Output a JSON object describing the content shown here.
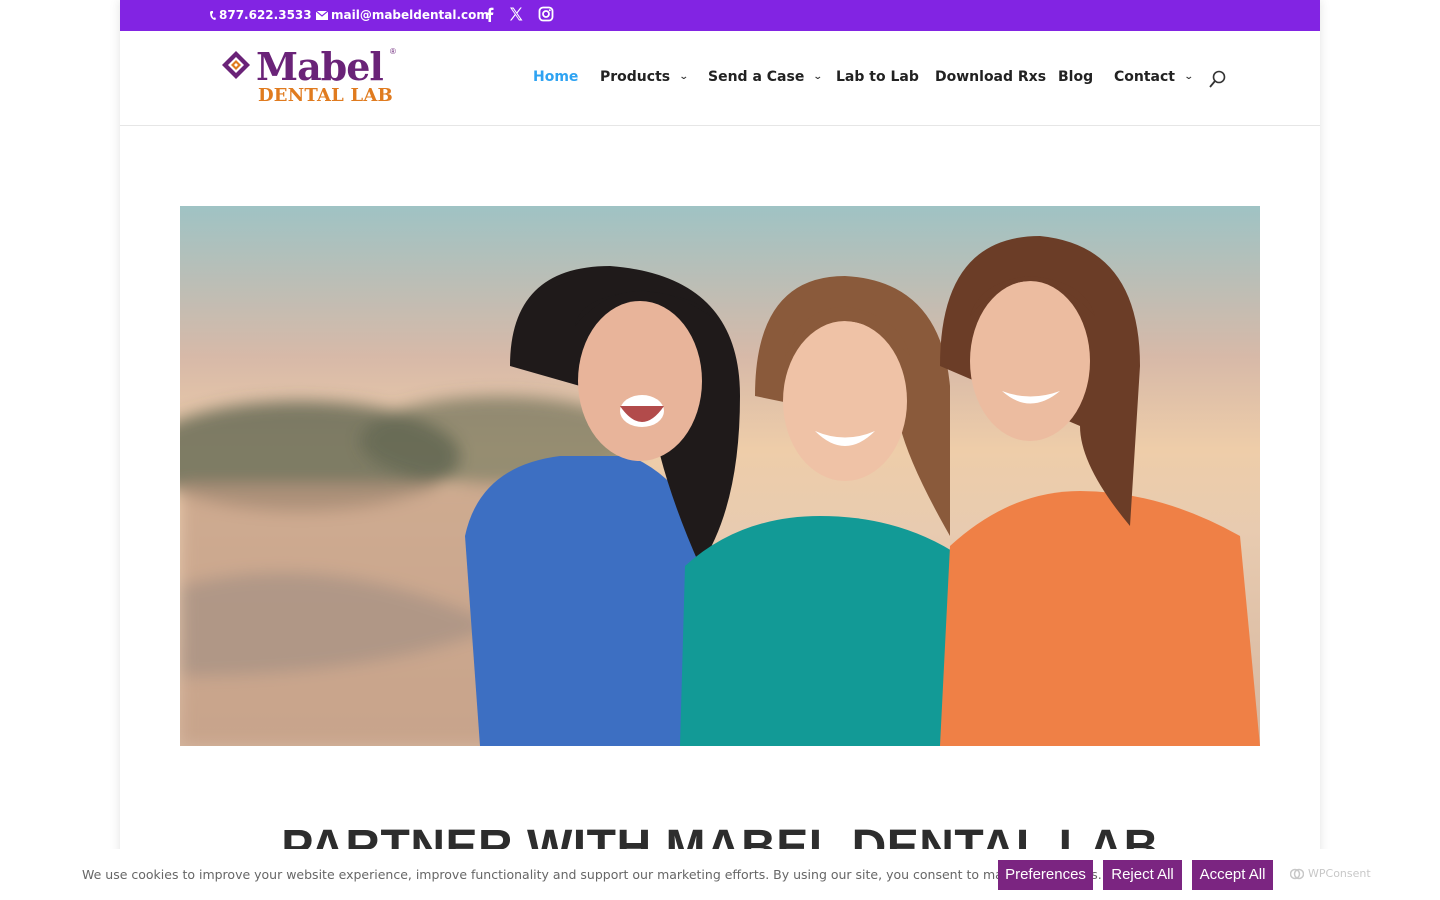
{
  "topbar": {
    "phone": "877.622.3533",
    "email": "mail@mabeldental.com",
    "social": [
      "facebook-icon",
      "x-icon",
      "instagram-icon"
    ],
    "bg_color": "#8224e3"
  },
  "logo": {
    "line1": "Mabel",
    "line2": "DENTAL LAB",
    "reg": "®"
  },
  "nav": {
    "items": [
      {
        "label": "Home",
        "active": true,
        "dropdown": false
      },
      {
        "label": "Products",
        "active": false,
        "dropdown": true
      },
      {
        "label": "Send a Case",
        "active": false,
        "dropdown": true
      },
      {
        "label": "Lab to Lab",
        "active": false,
        "dropdown": false
      },
      {
        "label": "Download Rxs",
        "active": false,
        "dropdown": false
      },
      {
        "label": "Blog",
        "active": false,
        "dropdown": false
      },
      {
        "label": "Contact",
        "active": false,
        "dropdown": true
      }
    ],
    "active_color": "#2ea3f2"
  },
  "main": {
    "headline": "PARTNER WITH MABEL DENTAL LAB"
  },
  "cookie": {
    "text": "We use cookies to improve your website experience, improve functionality and support our marketing efforts. By using our site, you consent to marketing cookies.",
    "preferences_label": "Preferences",
    "reject_label": "Reject All",
    "accept_label": "Accept All",
    "brand": "WPConsent",
    "button_color": "#7b2581"
  }
}
